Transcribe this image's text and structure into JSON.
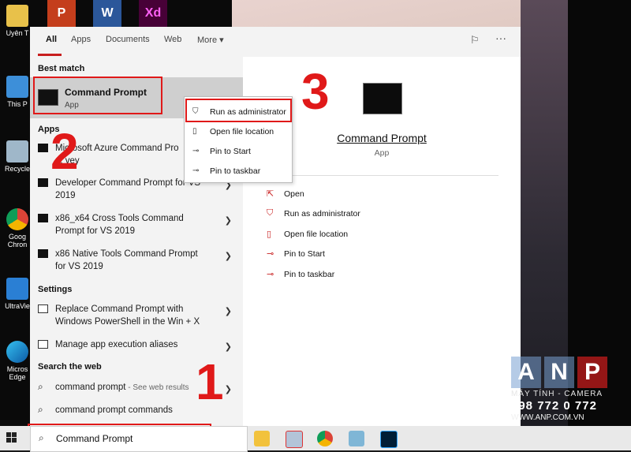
{
  "desktop": {
    "icons": [
      {
        "label": "Uyên T"
      },
      {
        "label": "This P"
      },
      {
        "label": "Recycle"
      },
      {
        "label": "Goog Chron"
      },
      {
        "label": "UltraVie"
      },
      {
        "label": "Micros Edge"
      }
    ],
    "top_apps": [
      {
        "letter": "P",
        "icon": "powerpoint-icon"
      },
      {
        "letter": "W",
        "icon": "word-icon"
      },
      {
        "letter": "Xd",
        "icon": "adobe-xd-icon"
      }
    ]
  },
  "tabs": [
    "All",
    "Apps",
    "Documents",
    "Web",
    "More ▾"
  ],
  "sections": {
    "best_match": "Best match",
    "apps": "Apps",
    "settings": "Settings",
    "search_web": "Search the web"
  },
  "best_match": {
    "title": "Command Prompt",
    "subtitle": "App"
  },
  "apps": [
    {
      "line1": "Microsoft Azure Command Pro",
      "line2": "... vey"
    },
    {
      "line1": "Developer Command Prompt for VS",
      "line2": "2019"
    },
    {
      "line1": "x86_x64 Cross Tools Command",
      "line2": "Prompt for VS 2019"
    },
    {
      "line1": "x86 Native Tools Command Prompt",
      "line2": "for VS 2019"
    }
  ],
  "settings": [
    {
      "line1": "Replace Command Prompt with",
      "line2": "Windows PowerShell in the Win + X"
    },
    {
      "line1": "Manage app execution aliases"
    }
  ],
  "web": [
    {
      "text": "command prompt",
      "hint": " - See web results"
    },
    {
      "text": "command prompt commands"
    }
  ],
  "context_menu": [
    {
      "label": "Run as administrator",
      "icon": "shield-icon"
    },
    {
      "label": "Open file location",
      "icon": "folder-icon"
    },
    {
      "label": "Pin to Start",
      "icon": "pin-icon"
    },
    {
      "label": "Pin to taskbar",
      "icon": "pin-icon"
    }
  ],
  "preview": {
    "title": "Command Prompt",
    "subtitle": "App",
    "actions": [
      {
        "label": "Open",
        "icon": "open-icon"
      },
      {
        "label": "Run as administrator",
        "icon": "shield-icon"
      },
      {
        "label": "Open file location",
        "icon": "folder-icon"
      },
      {
        "label": "Pin to Start",
        "icon": "pin-icon"
      },
      {
        "label": "Pin to taskbar",
        "icon": "pin-icon"
      }
    ]
  },
  "annotations": [
    "1",
    "2",
    "3"
  ],
  "search": {
    "value": "Command Prompt"
  },
  "watermark": {
    "letters": [
      "A",
      "N",
      "P"
    ],
    "tagline": "MÁY TÍNH - CAMERA",
    "phone": "098 772 0 772",
    "website": "WWW.ANP.COM.VN"
  },
  "colors": {
    "annotation_red": "#e01919",
    "accent": "#c81e1e"
  }
}
